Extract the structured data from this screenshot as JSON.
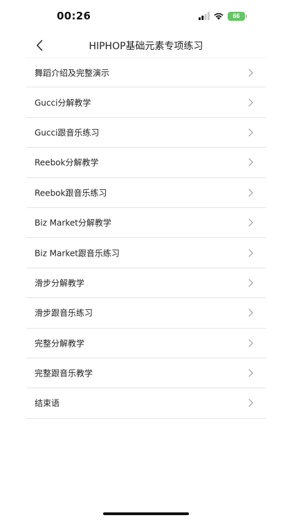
{
  "status_bar": {
    "time": "00:26",
    "battery_level": "66",
    "icons": [
      "signal-icon",
      "wifi-icon",
      "battery-icon"
    ],
    "battery_color": "#65c466"
  },
  "nav": {
    "title": "HIPHOP基础元素专项练习",
    "back_icon": "chevron-left-icon"
  },
  "list": {
    "items": [
      {
        "label": "舞蹈介绍及完整演示"
      },
      {
        "label": "Gucci分解教学"
      },
      {
        "label": "Gucci跟音乐练习"
      },
      {
        "label": "Reebok分解教学"
      },
      {
        "label": "Reebok跟音乐练习"
      },
      {
        "label": "Biz Market分解教学"
      },
      {
        "label": "Biz Market跟音乐练习"
      },
      {
        "label": "滑步分解教学"
      },
      {
        "label": "滑步跟音乐练习"
      },
      {
        "label": "完整分解教学"
      },
      {
        "label": "完整跟音乐教学"
      },
      {
        "label": "结束语"
      }
    ],
    "item_icon": "chevron-right-icon"
  }
}
